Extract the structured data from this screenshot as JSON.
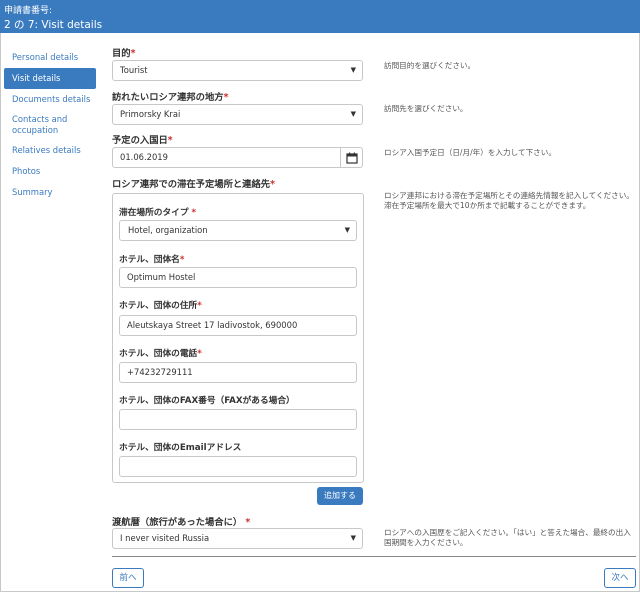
{
  "header": {
    "app_number_label": "申請書番号:",
    "step_title": "2 の 7: Visit details"
  },
  "sidebar": {
    "items": [
      {
        "label": "Personal details",
        "active": false
      },
      {
        "label": "Visit details",
        "active": true
      },
      {
        "label": "Documents details",
        "active": false
      },
      {
        "label": "Contacts and occupation",
        "active": false
      },
      {
        "label": "Relatives details",
        "active": false
      },
      {
        "label": "Photos",
        "active": false
      },
      {
        "label": "Summary",
        "active": false
      }
    ]
  },
  "form": {
    "purpose": {
      "label": "目的",
      "value": "Tourist",
      "help": "訪問目的を選びください。"
    },
    "region": {
      "label": "訪れたいロシア連邦の地方",
      "value": "Primorsky Krai",
      "help": "訪問先を選びください。"
    },
    "entry_date": {
      "label": "予定の入国日",
      "value": "01.06.2019",
      "help": "ロシア入国予定日（日/月/年）を入力して下さい。"
    },
    "stay": {
      "label": "ロシア連邦での滞在予定場所と連絡先",
      "help": "ロシア連邦における滞在予定場所とその連絡先情報を記入してください。滞在予定場所を最大で10か所まで記載することができます。",
      "place_type": {
        "label": "滞在場所のタイプ",
        "value": "Hotel, organization"
      },
      "hotel_name": {
        "label": "ホテル、団体名",
        "value": "Optimum Hostel"
      },
      "hotel_address": {
        "label": "ホテル、団体の住所",
        "value": "Aleutskaya Street 17 ladivostok, 690000"
      },
      "hotel_phone": {
        "label": "ホテル、団体の電話",
        "value": "+74232729111"
      },
      "hotel_fax": {
        "label": "ホテル、団体のFAX番号（FAXがある場合）",
        "value": ""
      },
      "hotel_email": {
        "label": "ホテル、団体のEmailアドレス",
        "value": ""
      },
      "add_label": "追加する"
    },
    "travel_history": {
      "label": "渡航暦（旅行があった場合に）",
      "value": "I never visited Russia",
      "help": "ロシアへの入国歴をご記入ください。「はい」と答えた場合、最終の出入国期間を入力ください。"
    }
  },
  "nav": {
    "prev_label": "前へ",
    "next_label": "次へ"
  },
  "colors": {
    "accent": "#3a7bbf",
    "required": "#c9302c"
  }
}
